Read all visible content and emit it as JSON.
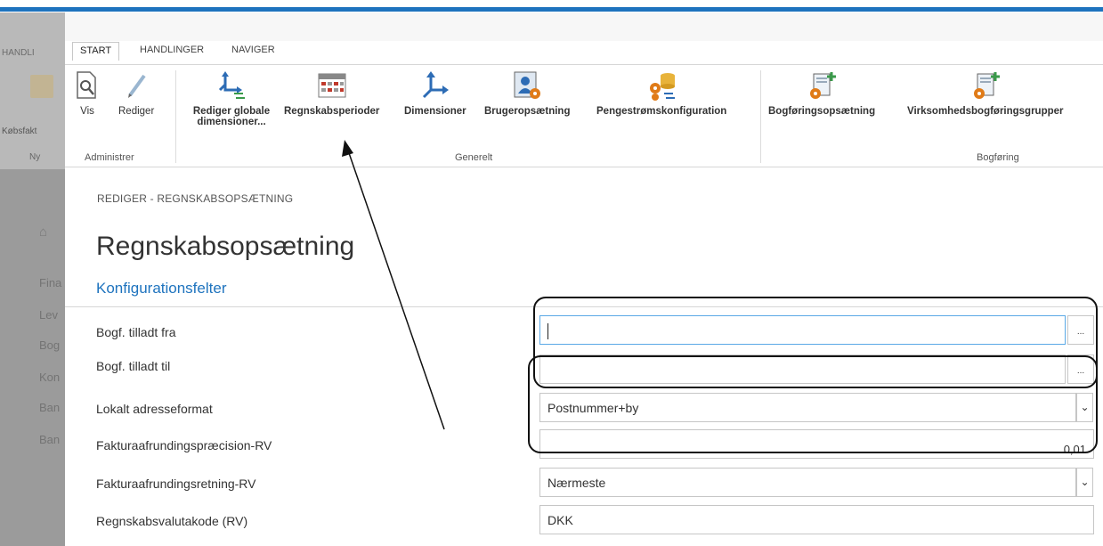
{
  "background_window": {
    "tab_label": "HANDLI",
    "button_label": "Købsfakt",
    "group_label": "Ny",
    "nav_items": [
      "Fina",
      "Lev",
      "Bog",
      "Kon",
      "Ban",
      "Ban"
    ]
  },
  "ribbon": {
    "tabs": [
      "START",
      "HANDLINGER",
      "NAVIGER"
    ],
    "buttons": {
      "vis": "Vis",
      "rediger": "Rediger",
      "rediger_globale": "Rediger globale",
      "rediger_globale_2": "dimensioner...",
      "regnskabsperioder": "Regnskabsperioder",
      "dimensioner": "Dimensioner",
      "brugeropsaetning": "Brugeropsætning",
      "pengestrom": "Pengestrømskonfiguration",
      "bogforingsopsaetning": "Bogføringsopsætning",
      "virksomhedsbogforing": "Virksomhedsbogføringsgrupper"
    },
    "groups": {
      "administrer": "Administrer",
      "generelt": "Generelt",
      "bogforing": "Bogføring"
    }
  },
  "page": {
    "breadcrumb": "REDIGER - REGNSKABSOPSÆTNING",
    "title": "Regnskabsopsætning",
    "section": "Konfigurationsfelter"
  },
  "fields": {
    "bogf_fra": {
      "label": "Bogf. tilladt fra",
      "value": ""
    },
    "bogf_til": {
      "label": "Bogf. tilladt til",
      "value": ""
    },
    "adresseformat": {
      "label": "Lokalt adresseformat",
      "value": "Postnummer+by"
    },
    "afrundingspraecision": {
      "label": "Fakturaafrundingspræcision-RV",
      "value": "0,01"
    },
    "afrundingsretning": {
      "label": "Fakturaafrundingsretning-RV",
      "value": "Nærmeste"
    },
    "valutakode": {
      "label": "Regnskabsvalutakode (RV)",
      "value": "DKK"
    }
  },
  "lookup_button_label": "...",
  "colors": {
    "accent": "#1e73be",
    "focus_border": "#5aa9e6"
  }
}
